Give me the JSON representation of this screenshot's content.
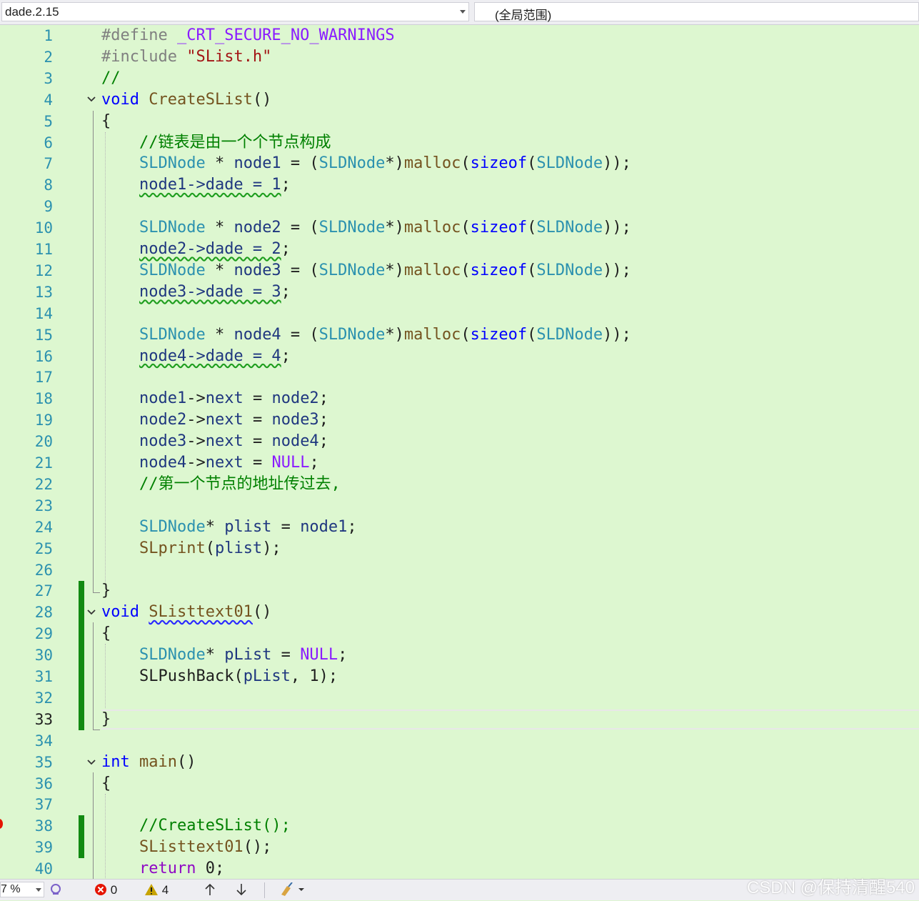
{
  "nav": {
    "project_dropdown": "dade.2.15",
    "scope_dropdown": "(全局范围)"
  },
  "editor": {
    "current_line": 33,
    "lines": [
      {
        "n": "1",
        "tokens": [
          [
            "#define ",
            "k-prep"
          ],
          [
            "_CRT_SECURE_NO_WARNINGS",
            "k-mac"
          ]
        ]
      },
      {
        "n": "2",
        "tokens": [
          [
            "#include ",
            "k-prep"
          ],
          [
            "\"SList.h\"",
            "k-str"
          ]
        ]
      },
      {
        "n": "3",
        "tokens": [
          [
            "//",
            "k-com"
          ]
        ]
      },
      {
        "n": "4",
        "tokens": [
          [
            "void",
            "k-kw"
          ],
          [
            " ",
            ""
          ],
          [
            "CreateSList",
            "k-fn"
          ],
          [
            "()",
            "k-pun"
          ]
        ]
      },
      {
        "n": "5",
        "tokens": [
          [
            "{",
            "k-pun"
          ]
        ]
      },
      {
        "n": "6",
        "tokens": [
          [
            "    //链表是由一个个节点构成",
            "k-com"
          ]
        ]
      },
      {
        "n": "7",
        "tokens": [
          [
            "    ",
            ""
          ],
          [
            "SLDNode",
            "k-type"
          ],
          [
            " * ",
            "k-pun"
          ],
          [
            "node1",
            "k-var"
          ],
          [
            " = (",
            "k-pun"
          ],
          [
            "SLDNode",
            "k-type"
          ],
          [
            "*)",
            "k-pun"
          ],
          [
            "malloc",
            "k-fn"
          ],
          [
            "(",
            "k-pun"
          ],
          [
            "sizeof",
            "k-kw"
          ],
          [
            "(",
            "k-pun"
          ],
          [
            "SLDNode",
            "k-type"
          ],
          [
            "));",
            "k-pun"
          ]
        ]
      },
      {
        "n": "8",
        "tokens": [
          [
            "    ",
            ""
          ],
          [
            "node1->dade = 1",
            "sq-g k-mem"
          ],
          [
            ";",
            "k-pun"
          ]
        ]
      },
      {
        "n": "9",
        "tokens": []
      },
      {
        "n": "10",
        "tokens": [
          [
            "    ",
            ""
          ],
          [
            "SLDNode",
            "k-type"
          ],
          [
            " * ",
            "k-pun"
          ],
          [
            "node2",
            "k-var"
          ],
          [
            " = (",
            "k-pun"
          ],
          [
            "SLDNode",
            "k-type"
          ],
          [
            "*)",
            "k-pun"
          ],
          [
            "malloc",
            "k-fn"
          ],
          [
            "(",
            "k-pun"
          ],
          [
            "sizeof",
            "k-kw"
          ],
          [
            "(",
            "k-pun"
          ],
          [
            "SLDNode",
            "k-type"
          ],
          [
            "));",
            "k-pun"
          ]
        ]
      },
      {
        "n": "11",
        "tokens": [
          [
            "    ",
            ""
          ],
          [
            "node2->dade = 2",
            "sq-g k-mem"
          ],
          [
            ";",
            "k-pun"
          ]
        ]
      },
      {
        "n": "12",
        "tokens": [
          [
            "    ",
            ""
          ],
          [
            "SLDNode",
            "k-type"
          ],
          [
            " * ",
            "k-pun"
          ],
          [
            "node3",
            "k-var"
          ],
          [
            " = (",
            "k-pun"
          ],
          [
            "SLDNode",
            "k-type"
          ],
          [
            "*)",
            "k-pun"
          ],
          [
            "malloc",
            "k-fn"
          ],
          [
            "(",
            "k-pun"
          ],
          [
            "sizeof",
            "k-kw"
          ],
          [
            "(",
            "k-pun"
          ],
          [
            "SLDNode",
            "k-type"
          ],
          [
            "));",
            "k-pun"
          ]
        ]
      },
      {
        "n": "13",
        "tokens": [
          [
            "    ",
            ""
          ],
          [
            "node3->dade = 3",
            "sq-g k-mem"
          ],
          [
            ";",
            "k-pun"
          ]
        ]
      },
      {
        "n": "14",
        "tokens": []
      },
      {
        "n": "15",
        "tokens": [
          [
            "    ",
            ""
          ],
          [
            "SLDNode",
            "k-type"
          ],
          [
            " * ",
            "k-pun"
          ],
          [
            "node4",
            "k-var"
          ],
          [
            " = (",
            "k-pun"
          ],
          [
            "SLDNode",
            "k-type"
          ],
          [
            "*)",
            "k-pun"
          ],
          [
            "malloc",
            "k-fn"
          ],
          [
            "(",
            "k-pun"
          ],
          [
            "sizeof",
            "k-kw"
          ],
          [
            "(",
            "k-pun"
          ],
          [
            "SLDNode",
            "k-type"
          ],
          [
            "));",
            "k-pun"
          ]
        ]
      },
      {
        "n": "16",
        "tokens": [
          [
            "    ",
            ""
          ],
          [
            "node4->dade = 4",
            "sq-g k-mem"
          ],
          [
            ";",
            "k-pun"
          ]
        ]
      },
      {
        "n": "17",
        "tokens": []
      },
      {
        "n": "18",
        "tokens": [
          [
            "    ",
            ""
          ],
          [
            "node1",
            "k-var"
          ],
          [
            "->",
            "k-pun"
          ],
          [
            "next",
            "k-mem"
          ],
          [
            " = ",
            "k-pun"
          ],
          [
            "node2",
            "k-var"
          ],
          [
            ";",
            "k-pun"
          ]
        ]
      },
      {
        "n": "19",
        "tokens": [
          [
            "    ",
            ""
          ],
          [
            "node2",
            "k-var"
          ],
          [
            "->",
            "k-pun"
          ],
          [
            "next",
            "k-mem"
          ],
          [
            " = ",
            "k-pun"
          ],
          [
            "node3",
            "k-var"
          ],
          [
            ";",
            "k-pun"
          ]
        ]
      },
      {
        "n": "20",
        "tokens": [
          [
            "    ",
            ""
          ],
          [
            "node3",
            "k-var"
          ],
          [
            "->",
            "k-pun"
          ],
          [
            "next",
            "k-mem"
          ],
          [
            " = ",
            "k-pun"
          ],
          [
            "node4",
            "k-var"
          ],
          [
            ";",
            "k-pun"
          ]
        ]
      },
      {
        "n": "21",
        "tokens": [
          [
            "    ",
            ""
          ],
          [
            "node4",
            "k-var"
          ],
          [
            "->",
            "k-pun"
          ],
          [
            "next",
            "k-mem"
          ],
          [
            " = ",
            "k-pun"
          ],
          [
            "NULL",
            "k-null"
          ],
          [
            ";",
            "k-pun"
          ]
        ]
      },
      {
        "n": "22",
        "tokens": [
          [
            "    //第一个节点的地址传过去,",
            "k-com"
          ]
        ]
      },
      {
        "n": "23",
        "tokens": []
      },
      {
        "n": "24",
        "tokens": [
          [
            "    ",
            ""
          ],
          [
            "SLDNode",
            "k-type"
          ],
          [
            "* ",
            "k-pun"
          ],
          [
            "plist",
            "k-var"
          ],
          [
            " = ",
            "k-pun"
          ],
          [
            "node1",
            "k-var"
          ],
          [
            ";",
            "k-pun"
          ]
        ]
      },
      {
        "n": "25",
        "tokens": [
          [
            "    ",
            ""
          ],
          [
            "SLprint",
            "k-fn"
          ],
          [
            "(",
            "k-pun"
          ],
          [
            "plist",
            "k-var"
          ],
          [
            ");",
            "k-pun"
          ]
        ]
      },
      {
        "n": "26",
        "tokens": []
      },
      {
        "n": "27",
        "tokens": [
          [
            "}",
            "k-pun"
          ]
        ]
      },
      {
        "n": "28",
        "tokens": [
          [
            "void",
            "k-kw"
          ],
          [
            " ",
            ""
          ],
          [
            "SListtext01",
            "sq-b k-fn"
          ],
          [
            "()",
            "k-pun"
          ]
        ]
      },
      {
        "n": "29",
        "tokens": [
          [
            "{",
            "k-pun"
          ]
        ]
      },
      {
        "n": "30",
        "tokens": [
          [
            "    ",
            ""
          ],
          [
            "SLDNode",
            "k-type"
          ],
          [
            "* ",
            "k-pun"
          ],
          [
            "pList",
            "k-var"
          ],
          [
            " = ",
            "k-pun"
          ],
          [
            "NULL",
            "k-null"
          ],
          [
            ";",
            "k-pun"
          ]
        ]
      },
      {
        "n": "31",
        "tokens": [
          [
            "    ",
            ""
          ],
          [
            "SLPushBack",
            "k-pun"
          ],
          [
            "(",
            "k-pun"
          ],
          [
            "pList",
            "k-var"
          ],
          [
            ", 1);",
            "k-pun"
          ]
        ]
      },
      {
        "n": "32",
        "tokens": []
      },
      {
        "n": "33",
        "tokens": [
          [
            "}",
            "k-pun"
          ]
        ]
      },
      {
        "n": "34",
        "tokens": []
      },
      {
        "n": "35",
        "tokens": [
          [
            "int",
            "k-kw"
          ],
          [
            " ",
            ""
          ],
          [
            "main",
            "k-fn"
          ],
          [
            "()",
            "k-pun"
          ]
        ]
      },
      {
        "n": "36",
        "tokens": [
          [
            "{",
            "k-pun"
          ]
        ]
      },
      {
        "n": "37",
        "tokens": []
      },
      {
        "n": "38",
        "tokens": [
          [
            "    //CreateSList();",
            "k-com"
          ]
        ]
      },
      {
        "n": "39",
        "tokens": [
          [
            "    ",
            ""
          ],
          [
            "SListtext01",
            "k-fn"
          ],
          [
            "();",
            "k-pun"
          ]
        ]
      },
      {
        "n": "40",
        "tokens": [
          [
            "    ",
            ""
          ],
          [
            "return",
            "k-ret"
          ],
          [
            " 0;",
            "k-pun"
          ]
        ]
      }
    ]
  },
  "status": {
    "zoom": "7 %",
    "errors": "0",
    "warnings": "4",
    "error_color": "#e51400",
    "warning_color": "#c7a300"
  },
  "watermark": "CSDN @保持清醒540"
}
